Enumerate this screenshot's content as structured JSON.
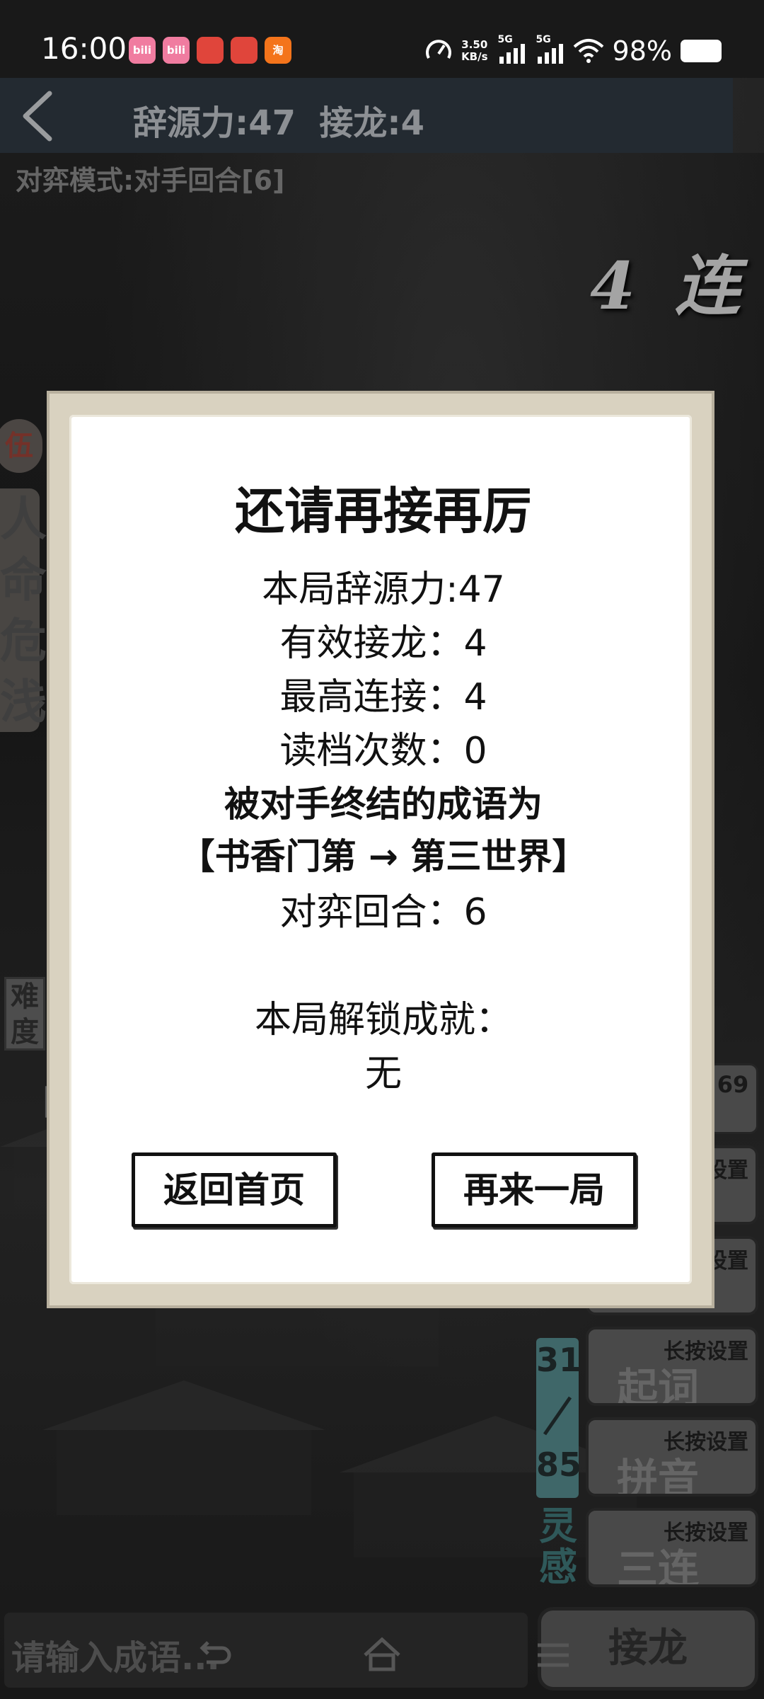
{
  "status_bar": {
    "time": "16:00",
    "app_icons": [
      {
        "name": "bilibili-icon",
        "label": "bili",
        "color": "#f07ca0"
      },
      {
        "name": "bilibili-icon",
        "label": "bili",
        "color": "#f07ca0"
      },
      {
        "name": "shop-icon",
        "label": "",
        "color": "#e0453b"
      },
      {
        "name": "mascot-icon",
        "label": "",
        "color": "#e0453b"
      },
      {
        "name": "taobao-icon",
        "label": "淘",
        "color": "#f4741b"
      }
    ],
    "net_speed_value": "3.50",
    "net_speed_unit": "KB/s",
    "signal_1": "5G",
    "signal_2": "5G",
    "battery": "98%"
  },
  "header": {
    "title": "辞源力:47  接龙:4"
  },
  "game": {
    "mode_label": "对弈模式:对手回合[6]",
    "combo_badge": "4 连",
    "left_rank": "伍",
    "left_hint": "人命危浅",
    "left_difficulty": "难度",
    "left_bracket": "【",
    "counter": "69",
    "side_buttons": [
      {
        "tag": "设置",
        "glyph": ""
      },
      {
        "tag": "设置",
        "glyph": ""
      },
      {
        "tag": "长按设置",
        "glyph": "起词"
      },
      {
        "tag": "长按设置",
        "glyph": "拼音"
      },
      {
        "tag": "长按设置",
        "glyph": "三连"
      }
    ],
    "progress_current": "31",
    "progress_total": "85",
    "inspire_label": "灵感",
    "input_placeholder": "请输入成语...",
    "submit_label": "接龙"
  },
  "dialog": {
    "title": "还请再接再厉",
    "score": "本局辞源力:47",
    "valid_chain": "有效接龙：4",
    "max_combo": "最高连接：4",
    "load_count": "读档次数：0",
    "ended_by_label": "被对手终结的成语为",
    "ended_by_value": "【书香门第 → 第三世界】",
    "rounds": "对弈回合：6",
    "achievements_label": "本局解锁成就：",
    "achievements_value": "无",
    "home_button": "返回首页",
    "retry_button": "再来一局"
  },
  "colors": {
    "dialog_frame": "#d9d2c0",
    "header_bg": "#232a31",
    "progress": "#4e7e80"
  }
}
